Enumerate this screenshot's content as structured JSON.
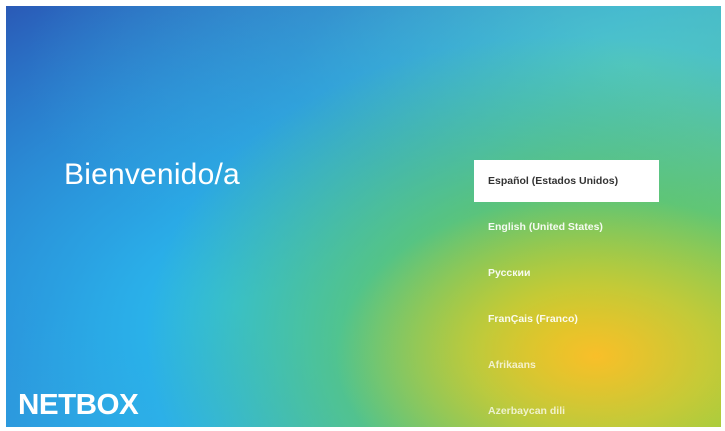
{
  "welcome": {
    "title": "Bienvenido/a"
  },
  "languages": {
    "items": [
      {
        "label": "Español (Estados Unidos)",
        "selected": true
      },
      {
        "label": "English (United States)",
        "selected": false
      },
      {
        "label": "Pусскии",
        "selected": false
      },
      {
        "label": "FranÇais (Franco)",
        "selected": false
      },
      {
        "label": "Afrikaans",
        "selected": false
      },
      {
        "label": "Azerbaycan dili",
        "selected": false
      }
    ]
  },
  "brand": {
    "logo_text": "NETBOX"
  },
  "colors": {
    "selected_bg": "#ffffff",
    "selected_text": "#333333",
    "text": "#ffffff"
  }
}
